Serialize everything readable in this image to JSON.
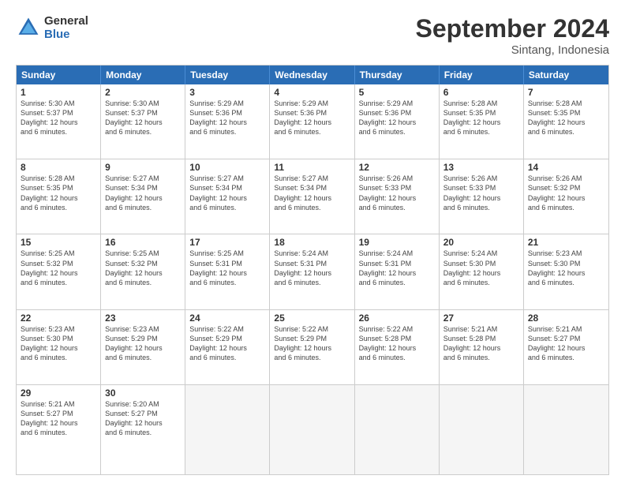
{
  "logo": {
    "line1": "General",
    "line2": "Blue"
  },
  "title": "September 2024",
  "subtitle": "Sintang, Indonesia",
  "headers": [
    "Sunday",
    "Monday",
    "Tuesday",
    "Wednesday",
    "Thursday",
    "Friday",
    "Saturday"
  ],
  "rows": [
    [
      {
        "day": "1",
        "info": "Sunrise: 5:30 AM\nSunset: 5:37 PM\nDaylight: 12 hours\nand 6 minutes."
      },
      {
        "day": "2",
        "info": "Sunrise: 5:30 AM\nSunset: 5:37 PM\nDaylight: 12 hours\nand 6 minutes."
      },
      {
        "day": "3",
        "info": "Sunrise: 5:29 AM\nSunset: 5:36 PM\nDaylight: 12 hours\nand 6 minutes."
      },
      {
        "day": "4",
        "info": "Sunrise: 5:29 AM\nSunset: 5:36 PM\nDaylight: 12 hours\nand 6 minutes."
      },
      {
        "day": "5",
        "info": "Sunrise: 5:29 AM\nSunset: 5:36 PM\nDaylight: 12 hours\nand 6 minutes."
      },
      {
        "day": "6",
        "info": "Sunrise: 5:28 AM\nSunset: 5:35 PM\nDaylight: 12 hours\nand 6 minutes."
      },
      {
        "day": "7",
        "info": "Sunrise: 5:28 AM\nSunset: 5:35 PM\nDaylight: 12 hours\nand 6 minutes."
      }
    ],
    [
      {
        "day": "8",
        "info": "Sunrise: 5:28 AM\nSunset: 5:35 PM\nDaylight: 12 hours\nand 6 minutes."
      },
      {
        "day": "9",
        "info": "Sunrise: 5:27 AM\nSunset: 5:34 PM\nDaylight: 12 hours\nand 6 minutes."
      },
      {
        "day": "10",
        "info": "Sunrise: 5:27 AM\nSunset: 5:34 PM\nDaylight: 12 hours\nand 6 minutes."
      },
      {
        "day": "11",
        "info": "Sunrise: 5:27 AM\nSunset: 5:34 PM\nDaylight: 12 hours\nand 6 minutes."
      },
      {
        "day": "12",
        "info": "Sunrise: 5:26 AM\nSunset: 5:33 PM\nDaylight: 12 hours\nand 6 minutes."
      },
      {
        "day": "13",
        "info": "Sunrise: 5:26 AM\nSunset: 5:33 PM\nDaylight: 12 hours\nand 6 minutes."
      },
      {
        "day": "14",
        "info": "Sunrise: 5:26 AM\nSunset: 5:32 PM\nDaylight: 12 hours\nand 6 minutes."
      }
    ],
    [
      {
        "day": "15",
        "info": "Sunrise: 5:25 AM\nSunset: 5:32 PM\nDaylight: 12 hours\nand 6 minutes."
      },
      {
        "day": "16",
        "info": "Sunrise: 5:25 AM\nSunset: 5:32 PM\nDaylight: 12 hours\nand 6 minutes."
      },
      {
        "day": "17",
        "info": "Sunrise: 5:25 AM\nSunset: 5:31 PM\nDaylight: 12 hours\nand 6 minutes."
      },
      {
        "day": "18",
        "info": "Sunrise: 5:24 AM\nSunset: 5:31 PM\nDaylight: 12 hours\nand 6 minutes."
      },
      {
        "day": "19",
        "info": "Sunrise: 5:24 AM\nSunset: 5:31 PM\nDaylight: 12 hours\nand 6 minutes."
      },
      {
        "day": "20",
        "info": "Sunrise: 5:24 AM\nSunset: 5:30 PM\nDaylight: 12 hours\nand 6 minutes."
      },
      {
        "day": "21",
        "info": "Sunrise: 5:23 AM\nSunset: 5:30 PM\nDaylight: 12 hours\nand 6 minutes."
      }
    ],
    [
      {
        "day": "22",
        "info": "Sunrise: 5:23 AM\nSunset: 5:30 PM\nDaylight: 12 hours\nand 6 minutes."
      },
      {
        "day": "23",
        "info": "Sunrise: 5:23 AM\nSunset: 5:29 PM\nDaylight: 12 hours\nand 6 minutes."
      },
      {
        "day": "24",
        "info": "Sunrise: 5:22 AM\nSunset: 5:29 PM\nDaylight: 12 hours\nand 6 minutes."
      },
      {
        "day": "25",
        "info": "Sunrise: 5:22 AM\nSunset: 5:29 PM\nDaylight: 12 hours\nand 6 minutes."
      },
      {
        "day": "26",
        "info": "Sunrise: 5:22 AM\nSunset: 5:28 PM\nDaylight: 12 hours\nand 6 minutes."
      },
      {
        "day": "27",
        "info": "Sunrise: 5:21 AM\nSunset: 5:28 PM\nDaylight: 12 hours\nand 6 minutes."
      },
      {
        "day": "28",
        "info": "Sunrise: 5:21 AM\nSunset: 5:27 PM\nDaylight: 12 hours\nand 6 minutes."
      }
    ],
    [
      {
        "day": "29",
        "info": "Sunrise: 5:21 AM\nSunset: 5:27 PM\nDaylight: 12 hours\nand 6 minutes."
      },
      {
        "day": "30",
        "info": "Sunrise: 5:20 AM\nSunset: 5:27 PM\nDaylight: 12 hours\nand 6 minutes."
      },
      {
        "day": "",
        "info": ""
      },
      {
        "day": "",
        "info": ""
      },
      {
        "day": "",
        "info": ""
      },
      {
        "day": "",
        "info": ""
      },
      {
        "day": "",
        "info": ""
      }
    ]
  ]
}
